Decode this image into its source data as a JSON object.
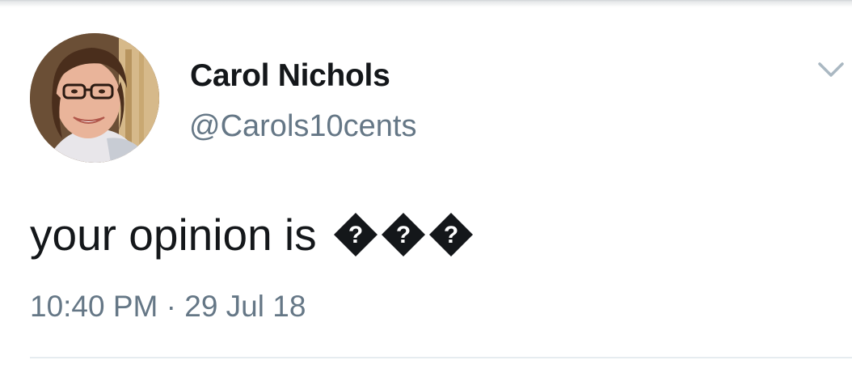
{
  "tweet": {
    "author": {
      "display_name": "Carol Nichols",
      "handle": "@Carols10cents",
      "avatar_icon": "profile-photo"
    },
    "text": "your opinion is",
    "replacement_glyphs": [
      "?",
      "?",
      "?"
    ],
    "timestamp": "10:40 PM · 29 Jul 18",
    "menu_icon": "chevron-down-icon"
  },
  "colors": {
    "text_primary": "#14171a",
    "text_secondary": "#657786",
    "divider": "#e6ecf0",
    "chevron": "#aab8c2"
  }
}
